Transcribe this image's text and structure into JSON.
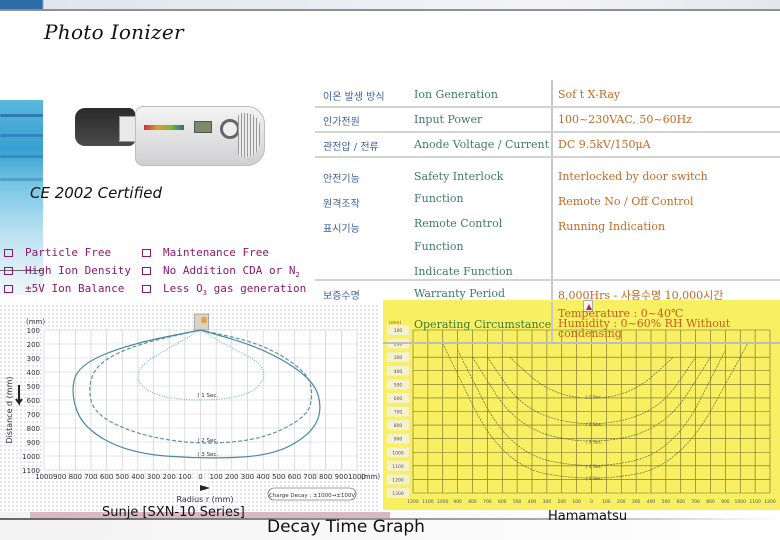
{
  "title": "Photo Ionizer",
  "certification": "CE 2002 Certified",
  "features_left": [
    {
      "text": "Particle Free"
    },
    {
      "text": "High Ion Density"
    },
    {
      "text": "±5V Ion Balance"
    }
  ],
  "features_right": [
    {
      "text": "Maintenance Free"
    },
    {
      "pre": "No Addition CDA or N",
      "sub": "2",
      "post": ""
    },
    {
      "pre": "Less O",
      "sub": "3",
      "post": " gas generation"
    }
  ],
  "specs": [
    {
      "ko": "이온 발생 방식",
      "en": "Ion Generation",
      "val": "Sof t X-Ray"
    },
    {
      "ko": "인가전원",
      "en": "Input Power",
      "val": "100~230VAC, 50~60Hz"
    },
    {
      "ko": "관전압 / 전류",
      "en": "Anode Voltage / Current",
      "val": "DC 9.5kV/150μA"
    },
    {
      "ko": "안전기능",
      "en": "Safety Interlock",
      "val": "Interlocked by door switch"
    },
    {
      "ko": "원격조작",
      "en": "Function",
      "val": "Remote No / Off Control"
    },
    {
      "ko": "표시기능",
      "en": "Remote Control",
      "val": "Running Indication"
    },
    {
      "ko": "",
      "en": "Function",
      "val": ""
    },
    {
      "ko": "",
      "en": "Indicate Function",
      "val": ""
    },
    {
      "ko": "보증수명",
      "en": "Warranty Period",
      "val": "8,000Hrs - 사용수명 10,000시간"
    }
  ],
  "operating": {
    "label": "Operating Circumstance",
    "lines": [
      "Temperature : 0~40℃",
      "Humidity : 0~60% RH Without",
      "condensing"
    ]
  },
  "captions": {
    "left": "Sunje [SXN-10 Series]",
    "center": "Decay Time Graph",
    "right": "Hamamatsu"
  },
  "chart_data": [
    {
      "type": "line",
      "title": "Sunje [SXN-10 Series]",
      "xlabel": "Radius r (mm)",
      "ylabel": "Distance d (mm)",
      "y_unit": "(mm)",
      "x_unit": "(mm)",
      "x_ticks": [
        "1000",
        "900",
        "800",
        "700",
        "600",
        "500",
        "400",
        "300",
        "200",
        "100",
        "0",
        "100",
        "200",
        "300",
        "400",
        "500",
        "600",
        "700",
        "800",
        "900",
        "1000"
      ],
      "y_ticks": [
        "100",
        "200",
        "300",
        "400",
        "500",
        "600",
        "700",
        "800",
        "900",
        "1000",
        "1100"
      ],
      "xlim": [
        -1000,
        1000
      ],
      "ylim": [
        100,
        1100
      ],
      "grid": true,
      "annotation": "Charge Decay : ±1000→±100V",
      "series": [
        {
          "name": "1 Sec.",
          "style": "dotted",
          "x": [
            0,
            -200,
            -360,
            -420,
            -300,
            0,
            300,
            420,
            380,
            200,
            0
          ],
          "y": [
            100,
            230,
            330,
            450,
            570,
            610,
            570,
            450,
            330,
            230,
            100
          ]
        },
        {
          "name": "2 Sec.",
          "style": "dashed",
          "x": [
            0,
            -400,
            -650,
            -720,
            -680,
            -400,
            0,
            400,
            680,
            720,
            680,
            400,
            0
          ],
          "y": [
            100,
            200,
            330,
            500,
            700,
            850,
            920,
            880,
            720,
            560,
            400,
            200,
            100
          ]
        },
        {
          "name": "3 Sec.",
          "style": "solid",
          "x": [
            0,
            -450,
            -780,
            -830,
            -750,
            -450,
            0,
            450,
            700,
            780,
            720,
            400,
            0
          ],
          "y": [
            100,
            200,
            350,
            550,
            800,
            980,
            1020,
            1000,
            850,
            670,
            450,
            230,
            100
          ]
        }
      ]
    },
    {
      "type": "line",
      "title": "Hamamatsu",
      "y_unit": "(mm)",
      "x_ticks": [
        "1200",
        "1100",
        "1000",
        "900",
        "800",
        "700",
        "600",
        "500",
        "400",
        "300",
        "200",
        "100",
        "0",
        "100",
        "200",
        "300",
        "400",
        "500",
        "600",
        "700",
        "800",
        "900",
        "1000",
        "1100",
        "1200"
      ],
      "y_ticks": [
        "100",
        "200",
        "300",
        "400",
        "500",
        "600",
        "700",
        "800",
        "900",
        "1000",
        "1100",
        "1200",
        "1300"
      ],
      "xlim": [
        -1200,
        1200
      ],
      "ylim": [
        100,
        1300
      ],
      "grid": true,
      "series": [
        {
          "name": "1 Sec.",
          "x": [
            -550,
            -300,
            0,
            300,
            550
          ],
          "y": [
            300,
            550,
            620,
            550,
            300
          ]
        },
        {
          "name": "2 Sec.",
          "x": [
            -700,
            -450,
            0,
            450,
            700
          ],
          "y": [
            300,
            700,
            820,
            700,
            300
          ]
        },
        {
          "name": "3 Sec.",
          "x": [
            -800,
            -500,
            0,
            500,
            800
          ],
          "y": [
            300,
            820,
            950,
            820,
            300
          ]
        },
        {
          "name": "4 Sec.",
          "x": [
            -900,
            -550,
            0,
            550,
            900
          ],
          "y": [
            250,
            1000,
            1130,
            1000,
            250
          ]
        },
        {
          "name": "5 Sec.",
          "x": [
            -1000,
            -600,
            0,
            600,
            1050
          ],
          "y": [
            200,
            1100,
            1220,
            1100,
            200
          ]
        }
      ]
    }
  ]
}
